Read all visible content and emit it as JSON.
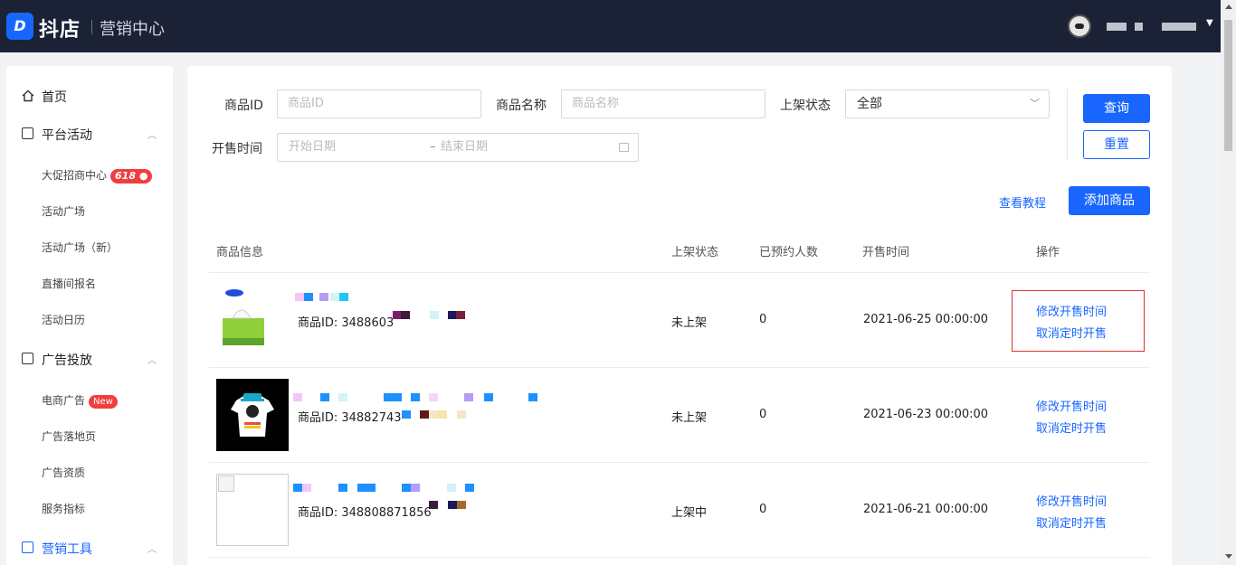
{
  "topbar": {
    "logo_mark": "D",
    "logo_text": "抖店",
    "logo_sub": "营销中心"
  },
  "sidebar": {
    "home": "首页",
    "platform_activity": {
      "label": "平台活动",
      "items": [
        {
          "label": "大促招商中心",
          "badge": "618"
        },
        {
          "label": "活动广场"
        },
        {
          "label": "活动广场（新）"
        },
        {
          "label": "直播间报名"
        },
        {
          "label": "活动日历"
        }
      ]
    },
    "ads": {
      "label": "广告投放",
      "items": [
        {
          "label": "电商广告",
          "badge": "New"
        },
        {
          "label": "广告落地页"
        },
        {
          "label": "广告资质"
        },
        {
          "label": "服务指标"
        }
      ]
    },
    "marketing_tools": {
      "label": "营销工具"
    }
  },
  "filters": {
    "product_id_label": "商品ID",
    "product_id_placeholder": "商品ID",
    "product_name_label": "商品名称",
    "product_name_placeholder": "商品名称",
    "status_label": "上架状态",
    "status_value": "全部",
    "sale_time_label": "开售时间",
    "start_date_placeholder": "开始日期",
    "end_date_placeholder": "结束日期",
    "date_sep": "–",
    "query_button": "查询",
    "reset_button": "重置"
  },
  "actions": {
    "tutorial_link": "查看教程",
    "add_product_button": "添加商品"
  },
  "table": {
    "headers": {
      "info": "商品信息",
      "status": "上架状态",
      "reserved": "已预约人数",
      "sale_time": "开售时间",
      "ops": "操作"
    },
    "rows": [
      {
        "product_id": "商品ID: 3488603",
        "status": "未上架",
        "reserved": "0",
        "sale_time": "2021-06-25 00:00:00",
        "op1": "修改开售时间",
        "op2": "取消定时开售"
      },
      {
        "product_id": "商品ID: 34882743",
        "status": "未上架",
        "reserved": "0",
        "sale_time": "2021-06-23 00:00:00",
        "op1": "修改开售时间",
        "op2": "取消定时开售"
      },
      {
        "product_id": "商品ID: 348808871856",
        "status": "上架中",
        "reserved": "0",
        "sale_time": "2021-06-21 00:00:00",
        "op1": "修改开售时间",
        "op2": "取消定时开售"
      }
    ]
  },
  "colors": {
    "topbar": "#1b2236",
    "accent": "#1966ff",
    "badge": "#f03e3e",
    "highlight": "#e03131"
  }
}
